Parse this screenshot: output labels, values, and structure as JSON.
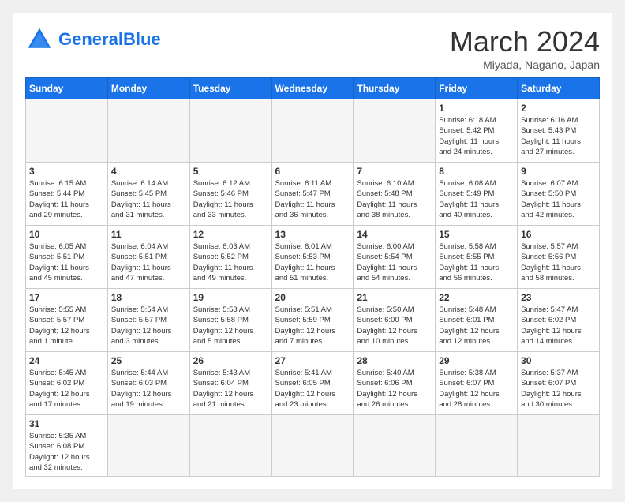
{
  "header": {
    "logo_general": "General",
    "logo_blue": "Blue",
    "month_title": "March 2024",
    "location": "Miyada, Nagano, Japan"
  },
  "days_of_week": [
    "Sunday",
    "Monday",
    "Tuesday",
    "Wednesday",
    "Thursday",
    "Friday",
    "Saturday"
  ],
  "weeks": [
    {
      "days": [
        {
          "number": "",
          "info": "",
          "empty": true
        },
        {
          "number": "",
          "info": "",
          "empty": true
        },
        {
          "number": "",
          "info": "",
          "empty": true
        },
        {
          "number": "",
          "info": "",
          "empty": true
        },
        {
          "number": "",
          "info": "",
          "empty": true
        },
        {
          "number": "1",
          "info": "Sunrise: 6:18 AM\nSunset: 5:42 PM\nDaylight: 11 hours\nand 24 minutes.",
          "empty": false
        },
        {
          "number": "2",
          "info": "Sunrise: 6:16 AM\nSunset: 5:43 PM\nDaylight: 11 hours\nand 27 minutes.",
          "empty": false
        }
      ]
    },
    {
      "days": [
        {
          "number": "3",
          "info": "Sunrise: 6:15 AM\nSunset: 5:44 PM\nDaylight: 11 hours\nand 29 minutes.",
          "empty": false
        },
        {
          "number": "4",
          "info": "Sunrise: 6:14 AM\nSunset: 5:45 PM\nDaylight: 11 hours\nand 31 minutes.",
          "empty": false
        },
        {
          "number": "5",
          "info": "Sunrise: 6:12 AM\nSunset: 5:46 PM\nDaylight: 11 hours\nand 33 minutes.",
          "empty": false
        },
        {
          "number": "6",
          "info": "Sunrise: 6:11 AM\nSunset: 5:47 PM\nDaylight: 11 hours\nand 36 minutes.",
          "empty": false
        },
        {
          "number": "7",
          "info": "Sunrise: 6:10 AM\nSunset: 5:48 PM\nDaylight: 11 hours\nand 38 minutes.",
          "empty": false
        },
        {
          "number": "8",
          "info": "Sunrise: 6:08 AM\nSunset: 5:49 PM\nDaylight: 11 hours\nand 40 minutes.",
          "empty": false
        },
        {
          "number": "9",
          "info": "Sunrise: 6:07 AM\nSunset: 5:50 PM\nDaylight: 11 hours\nand 42 minutes.",
          "empty": false
        }
      ]
    },
    {
      "days": [
        {
          "number": "10",
          "info": "Sunrise: 6:05 AM\nSunset: 5:51 PM\nDaylight: 11 hours\nand 45 minutes.",
          "empty": false
        },
        {
          "number": "11",
          "info": "Sunrise: 6:04 AM\nSunset: 5:51 PM\nDaylight: 11 hours\nand 47 minutes.",
          "empty": false
        },
        {
          "number": "12",
          "info": "Sunrise: 6:03 AM\nSunset: 5:52 PM\nDaylight: 11 hours\nand 49 minutes.",
          "empty": false
        },
        {
          "number": "13",
          "info": "Sunrise: 6:01 AM\nSunset: 5:53 PM\nDaylight: 11 hours\nand 51 minutes.",
          "empty": false
        },
        {
          "number": "14",
          "info": "Sunrise: 6:00 AM\nSunset: 5:54 PM\nDaylight: 11 hours\nand 54 minutes.",
          "empty": false
        },
        {
          "number": "15",
          "info": "Sunrise: 5:58 AM\nSunset: 5:55 PM\nDaylight: 11 hours\nand 56 minutes.",
          "empty": false
        },
        {
          "number": "16",
          "info": "Sunrise: 5:57 AM\nSunset: 5:56 PM\nDaylight: 11 hours\nand 58 minutes.",
          "empty": false
        }
      ]
    },
    {
      "days": [
        {
          "number": "17",
          "info": "Sunrise: 5:55 AM\nSunset: 5:57 PM\nDaylight: 12 hours\nand 1 minute.",
          "empty": false
        },
        {
          "number": "18",
          "info": "Sunrise: 5:54 AM\nSunset: 5:57 PM\nDaylight: 12 hours\nand 3 minutes.",
          "empty": false
        },
        {
          "number": "19",
          "info": "Sunrise: 5:53 AM\nSunset: 5:58 PM\nDaylight: 12 hours\nand 5 minutes.",
          "empty": false
        },
        {
          "number": "20",
          "info": "Sunrise: 5:51 AM\nSunset: 5:59 PM\nDaylight: 12 hours\nand 7 minutes.",
          "empty": false
        },
        {
          "number": "21",
          "info": "Sunrise: 5:50 AM\nSunset: 6:00 PM\nDaylight: 12 hours\nand 10 minutes.",
          "empty": false
        },
        {
          "number": "22",
          "info": "Sunrise: 5:48 AM\nSunset: 6:01 PM\nDaylight: 12 hours\nand 12 minutes.",
          "empty": false
        },
        {
          "number": "23",
          "info": "Sunrise: 5:47 AM\nSunset: 6:02 PM\nDaylight: 12 hours\nand 14 minutes.",
          "empty": false
        }
      ]
    },
    {
      "days": [
        {
          "number": "24",
          "info": "Sunrise: 5:45 AM\nSunset: 6:02 PM\nDaylight: 12 hours\nand 17 minutes.",
          "empty": false
        },
        {
          "number": "25",
          "info": "Sunrise: 5:44 AM\nSunset: 6:03 PM\nDaylight: 12 hours\nand 19 minutes.",
          "empty": false
        },
        {
          "number": "26",
          "info": "Sunrise: 5:43 AM\nSunset: 6:04 PM\nDaylight: 12 hours\nand 21 minutes.",
          "empty": false
        },
        {
          "number": "27",
          "info": "Sunrise: 5:41 AM\nSunset: 6:05 PM\nDaylight: 12 hours\nand 23 minutes.",
          "empty": false
        },
        {
          "number": "28",
          "info": "Sunrise: 5:40 AM\nSunset: 6:06 PM\nDaylight: 12 hours\nand 26 minutes.",
          "empty": false
        },
        {
          "number": "29",
          "info": "Sunrise: 5:38 AM\nSunset: 6:07 PM\nDaylight: 12 hours\nand 28 minutes.",
          "empty": false
        },
        {
          "number": "30",
          "info": "Sunrise: 5:37 AM\nSunset: 6:07 PM\nDaylight: 12 hours\nand 30 minutes.",
          "empty": false
        }
      ]
    },
    {
      "days": [
        {
          "number": "31",
          "info": "Sunrise: 5:35 AM\nSunset: 6:08 PM\nDaylight: 12 hours\nand 32 minutes.",
          "empty": false
        },
        {
          "number": "",
          "info": "",
          "empty": true
        },
        {
          "number": "",
          "info": "",
          "empty": true
        },
        {
          "number": "",
          "info": "",
          "empty": true
        },
        {
          "number": "",
          "info": "",
          "empty": true
        },
        {
          "number": "",
          "info": "",
          "empty": true
        },
        {
          "number": "",
          "info": "",
          "empty": true
        }
      ]
    }
  ]
}
